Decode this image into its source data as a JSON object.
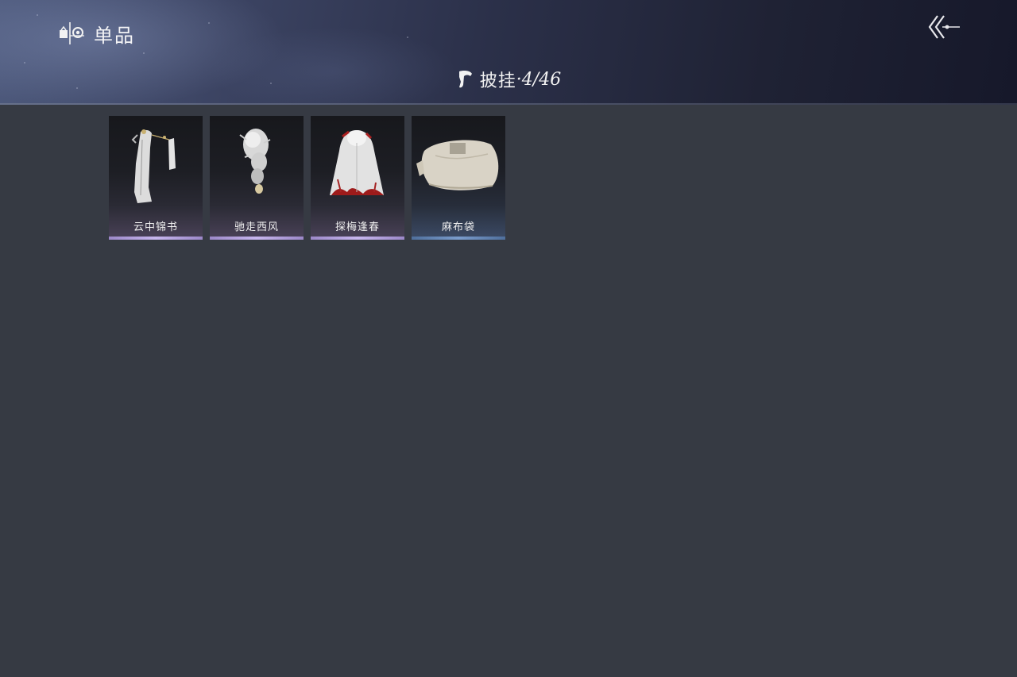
{
  "header": {
    "title": "单品",
    "category_label": "披挂",
    "category_count": "·4/46"
  },
  "items": [
    {
      "name": "云中锦书",
      "rarity_color": "#b9a6e4"
    },
    {
      "name": "驰走西风",
      "rarity_color": "#b9a6e4"
    },
    {
      "name": "探梅逢春",
      "rarity_color": "#b9a6e4"
    },
    {
      "name": "麻布袋",
      "rarity_color": "#6f8fbf"
    }
  ],
  "colors": {
    "background": "#363a43",
    "header_dark": "#16182a",
    "header_light": "#4e5a7d",
    "text": "#f2f2f2"
  },
  "icons": {
    "title": "wardrobe-hanger-icon",
    "back": "double-chevron-back-icon",
    "category": "cape-icon"
  }
}
